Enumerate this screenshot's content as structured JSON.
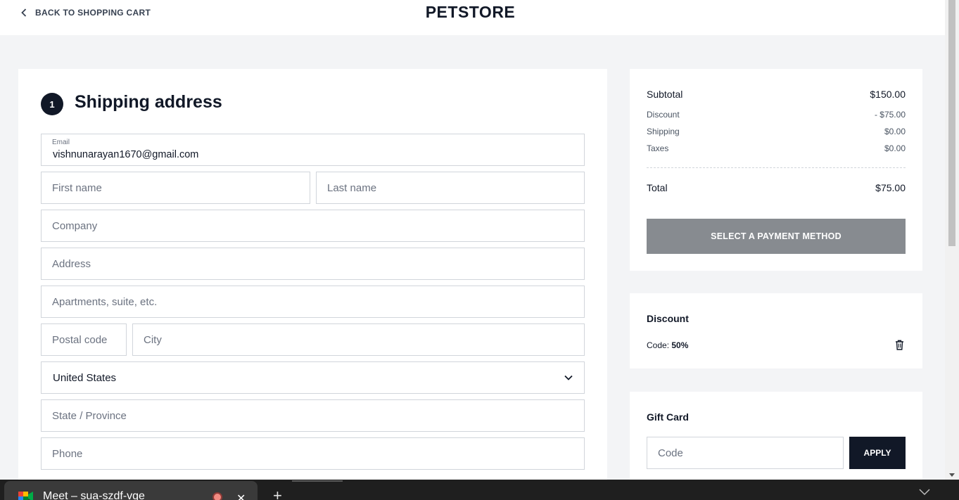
{
  "header": {
    "back_label": "BACK TO SHOPPING CART",
    "brand": "PETSTORE"
  },
  "shipping": {
    "step_number": "1",
    "title": "Shipping address",
    "email_label": "Email",
    "email_value": "vishnunarayan1670@gmail.com",
    "first_name_placeholder": "First name",
    "last_name_placeholder": "Last name",
    "company_placeholder": "Company",
    "address_placeholder": "Address",
    "apartment_placeholder": "Apartments, suite, etc.",
    "postal_placeholder": "Postal code",
    "city_placeholder": "City",
    "country_value": "United States",
    "state_placeholder": "State / Province",
    "phone_placeholder": "Phone"
  },
  "summary": {
    "subtotal_label": "Subtotal",
    "subtotal_value": "$150.00",
    "discount_label": "Discount",
    "discount_value": "- $75.00",
    "shipping_label": "Shipping",
    "shipping_value": "$0.00",
    "taxes_label": "Taxes",
    "taxes_value": "$0.00",
    "total_label": "Total",
    "total_value": "$75.00",
    "payment_button": "SELECT A PAYMENT METHOD"
  },
  "discount": {
    "heading": "Discount",
    "code_prefix": "Code: ",
    "code_value": "50%"
  },
  "gift_card": {
    "heading": "Gift Card",
    "code_placeholder": "Code",
    "apply_button": "APPLY"
  },
  "taskbar": {
    "tab_title": "Meet – sua-szdf-vge",
    "close_glyph": "✕",
    "new_tab_glyph": "+"
  },
  "colors": {
    "page_bg": "#f3f4f6",
    "primary_dark": "#111827",
    "payment_button_bg": "#878b90"
  },
  "icons": [
    "chevron-left-icon",
    "chevron-down-icon",
    "trash-icon",
    "meet-icon",
    "close-icon",
    "plus-icon"
  ]
}
